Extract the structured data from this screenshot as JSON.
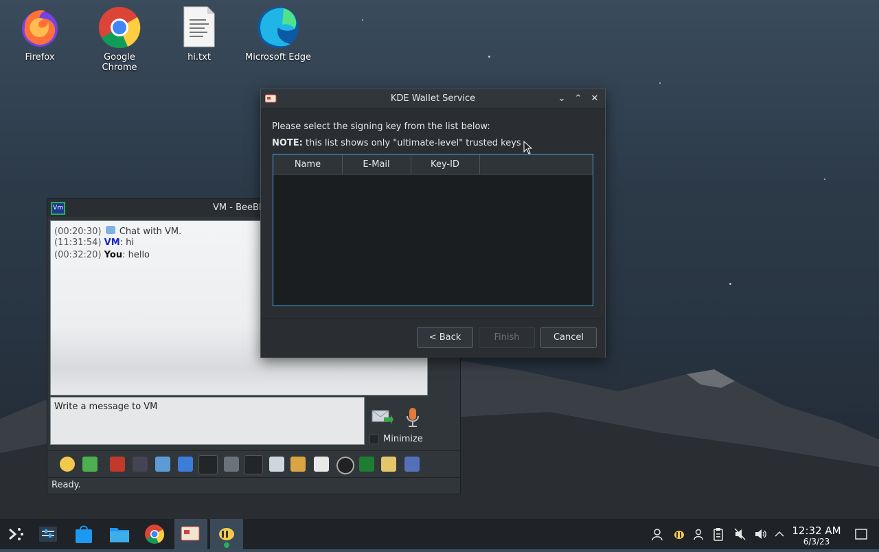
{
  "desktop": {
    "icons": [
      {
        "label": "Firefox",
        "icon": "firefox-icon"
      },
      {
        "label": "Google Chrome",
        "icon": "chrome-icon"
      },
      {
        "label": "hi.txt",
        "icon": "text-file-icon"
      },
      {
        "label": "Microsoft Edge",
        "icon": "edge-icon"
      }
    ]
  },
  "chat_window": {
    "title": "VM - BeeBE",
    "logo_text": "Vm",
    "messages": [
      {
        "time": "(00:20:30)",
        "sender": "",
        "text": "Chat with VM."
      },
      {
        "time": "(11:31:54)",
        "sender": "VM",
        "text": ": hi"
      },
      {
        "time": "(00:32:20)",
        "sender": "You",
        "text": ": hello"
      }
    ],
    "input_placeholder": "Write a message to VM",
    "minimize_label": "Minimize",
    "status": "Ready."
  },
  "dialog": {
    "title": "KDE Wallet Service",
    "instruction": "Please select the signing key from the list below:",
    "note_prefix": "NOTE:",
    "note_text": " this list shows only \"ultimate-level\" trusted keys",
    "columns": [
      "Name",
      "E-Mail",
      "Key-ID"
    ],
    "buttons": {
      "back": "< Back",
      "finish": "Finish",
      "cancel": "Cancel"
    }
  },
  "taskbar": {
    "clock_time": "12:32 AM",
    "clock_date": "6/3/23"
  }
}
